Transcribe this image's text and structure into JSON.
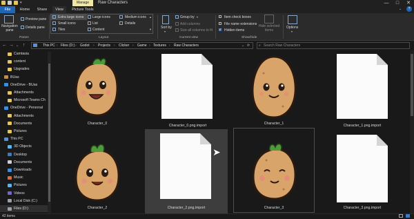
{
  "window": {
    "title": "Raw Characters",
    "tool_tab": "Manage",
    "controls": [
      "—",
      "□",
      "✕"
    ]
  },
  "ribbon_tabs": [
    "File",
    "Home",
    "Share",
    "View",
    "Picture Tools"
  ],
  "ribbon": {
    "panes": {
      "navigation_pane": "Navigation pane",
      "preview_pane": "Preview pane",
      "details_pane": "Details pane",
      "group": "Panes"
    },
    "layout": {
      "items": [
        "Extra large icons",
        "Large icons",
        "Medium icons",
        "Small icons",
        "List",
        "Details",
        "Tiles",
        "Content"
      ],
      "group": "Layout"
    },
    "current_view": {
      "sort_by": "Sort by",
      "group_by": "Group by",
      "add_columns": "Add columns",
      "size_all_columns": "Size all columns to fit",
      "group": "Current view"
    },
    "show_hide": {
      "item_check_boxes": "Item check boxes",
      "file_name_extensions": "File name extensions",
      "hidden_items": "Hidden items",
      "hide_selected_items": "Hide selected items",
      "group": "Show/hide"
    },
    "options": "Options"
  },
  "breadcrumb": [
    "This PC",
    "Files (D:)",
    "Godot",
    "Projects",
    "Clicker",
    "Game",
    "Textures",
    "Raw Characters"
  ],
  "search": {
    "placeholder": "Search Raw Characters"
  },
  "nav": {
    "items": [
      {
        "label": "Camtasia",
        "type": "folder"
      },
      {
        "label": "content",
        "type": "folder"
      },
      {
        "label": "Upgrades",
        "type": "folder"
      },
      {
        "label": "BUas",
        "type": "bag"
      },
      {
        "label": "OneDrive - BUas",
        "type": "cloud"
      },
      {
        "label": "Attachments",
        "type": "folder"
      },
      {
        "label": "Microsoft Teams Ch",
        "type": "folder"
      },
      {
        "label": "OneDrive - Personal",
        "type": "cloud"
      },
      {
        "label": "Attachments",
        "type": "folder"
      },
      {
        "label": "Documents",
        "type": "folder"
      },
      {
        "label": "Pictures",
        "type": "folder"
      },
      {
        "label": "This PC",
        "type": "pc"
      },
      {
        "label": "3D Objects",
        "type": "obj3d"
      },
      {
        "label": "Desktop",
        "type": "desk"
      },
      {
        "label": "Documents",
        "type": "docs"
      },
      {
        "label": "Downloads",
        "type": "down"
      },
      {
        "label": "Music",
        "type": "music"
      },
      {
        "label": "Pictures",
        "type": "pics"
      },
      {
        "label": "Videos",
        "type": "video"
      },
      {
        "label": "Local Disk (C:)",
        "type": "drive"
      },
      {
        "label": "Files (D:)",
        "type": "drive"
      }
    ]
  },
  "files": [
    {
      "name": "Character_0",
      "kind": "image"
    },
    {
      "name": "Character_0.png.import",
      "kind": "doc"
    },
    {
      "name": "Character_1",
      "kind": "image"
    },
    {
      "name": "Character_1.png.import",
      "kind": "doc"
    },
    {
      "name": "Character_2",
      "kind": "image"
    },
    {
      "name": "Character_2.png.import",
      "kind": "doc"
    },
    {
      "name": "Character_3",
      "kind": "image"
    },
    {
      "name": "Character_3.png.import",
      "kind": "doc"
    }
  ],
  "status": {
    "items": "42 items"
  },
  "colors": {
    "accent": "#1f66b7",
    "manage_tab": "#f0e6a8",
    "potato": "#d9a46a",
    "leaf": "#4f9a3a"
  }
}
